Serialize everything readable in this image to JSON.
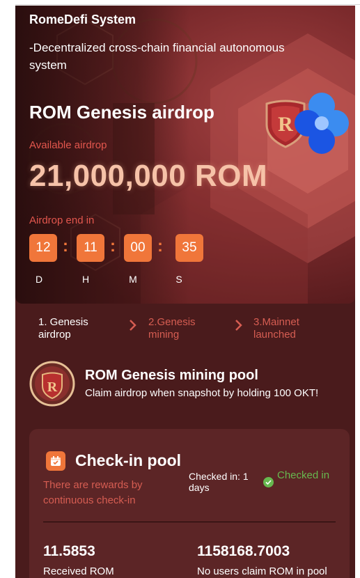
{
  "header": {
    "title": "RomeDefi System",
    "subtitle": "-Decentralized cross-chain financial autonomous system"
  },
  "hero": {
    "airdrop_title": "ROM Genesis airdrop",
    "available_label": "Available airdrop",
    "available_value": "21,000,000 ROM",
    "end_label": "Airdrop end in",
    "countdown": [
      {
        "value": "12",
        "unit": "D"
      },
      {
        "value": "11",
        "unit": "H"
      },
      {
        "value": "00",
        "unit": "M"
      },
      {
        "value": "35",
        "unit": "S"
      }
    ],
    "colon": ":",
    "icons": [
      "rome-shield-logo-icon",
      "okx-logo-icon"
    ]
  },
  "steps": [
    {
      "label": "1. Genesis airdrop",
      "active": true
    },
    {
      "label": "2.Genesis mining",
      "active": false
    },
    {
      "label": "3.Mainnet launched",
      "active": false
    }
  ],
  "mining_pool": {
    "title": "ROM Genesis mining pool",
    "description": "Claim airdrop when snapshot by holding 100 OKT!"
  },
  "checkin": {
    "title": "Check-in pool",
    "description": "There are rewards by continuous check-in",
    "checked_in_label": "Checked in: 1 days",
    "status": "Checked in",
    "received_value": "11.5853",
    "received_label": "Received ROM",
    "pool_value": "1158168.7003",
    "pool_label": "No users claim ROM in pool"
  },
  "colors": {
    "accent": "#f0763a",
    "muted_red": "#d65d52",
    "success": "#67b84f",
    "background": "#4a1b1c",
    "card": "#5c2526"
  }
}
